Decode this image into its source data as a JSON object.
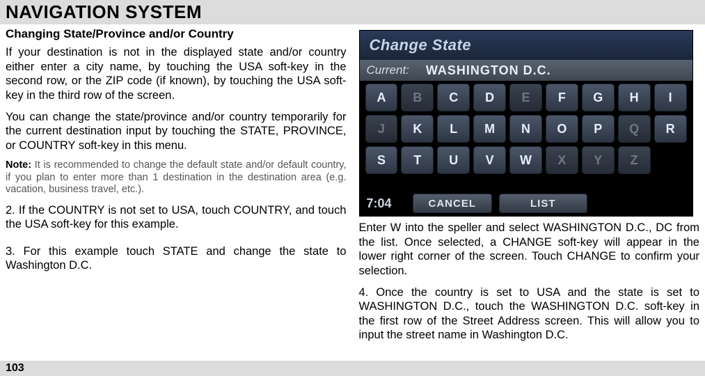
{
  "page": {
    "number": "103"
  },
  "title": "NAVIGATION SYSTEM",
  "left": {
    "subhead": "Changing State/Province and/or Country",
    "p1": "If your destination is not in the displayed state and/or country either enter a city name, by touching the USA soft-key in the second row, or the ZIP code (if known), by touching the USA soft-key in the third row of the screen.",
    "p2": "You can change the state/province and/or country temporarily for the current destination input by touching the STATE, PROVINCE, or COUNTRY soft-key in this menu.",
    "note_label": "Note:",
    "note_body": " It is recommended to change the default state and/or default country, if you plan to enter more than 1 destination in the destination area (e.g. vacation, business travel, etc.).",
    "p3": "2. If the COUNTRY is not set to USA, touch COUNTRY, and touch the USA soft-key for this example.",
    "p4": "3. For this example touch STATE and change the state to Washington D.C."
  },
  "right": {
    "p1": "Enter W into the speller and select WASHINGTON D.C., DC from the list. Once selected, a CHANGE soft-key will appear in the lower right corner of the screen. Touch CHANGE to confirm your selection.",
    "p2": "4. Once the country is set to USA and the state is set to WASHINGTON D.C., touch the WASHINGTON D.C. soft-key in the first row of the Street Address screen. This will allow you to input the street name in Washington D.C."
  },
  "screenshot": {
    "header": "Change State",
    "current_label": "Current:",
    "current_value": "WASHINGTON D.C.",
    "rows": [
      [
        {
          "k": "A",
          "dim": false
        },
        {
          "k": "B",
          "dim": true
        },
        {
          "k": "C",
          "dim": false
        },
        {
          "k": "D",
          "dim": false
        },
        {
          "k": "E",
          "dim": true
        },
        {
          "k": "F",
          "dim": false
        },
        {
          "k": "G",
          "dim": false
        },
        {
          "k": "H",
          "dim": false
        },
        {
          "k": "I",
          "dim": false
        }
      ],
      [
        {
          "k": "J",
          "dim": true
        },
        {
          "k": "K",
          "dim": false
        },
        {
          "k": "L",
          "dim": false
        },
        {
          "k": "M",
          "dim": false
        },
        {
          "k": "N",
          "dim": false
        },
        {
          "k": "O",
          "dim": false
        },
        {
          "k": "P",
          "dim": false
        },
        {
          "k": "Q",
          "dim": true
        },
        {
          "k": "R",
          "dim": false
        }
      ],
      [
        {
          "k": "S",
          "dim": false
        },
        {
          "k": "T",
          "dim": false
        },
        {
          "k": "U",
          "dim": false
        },
        {
          "k": "V",
          "dim": false
        },
        {
          "k": "W",
          "dim": false
        },
        {
          "k": "X",
          "dim": true
        },
        {
          "k": "Y",
          "dim": true
        },
        {
          "k": "Z",
          "dim": true
        },
        {
          "k": "",
          "dim": true
        }
      ]
    ],
    "clock": "7:04",
    "cancel": "CANCEL",
    "list": "LIST"
  }
}
